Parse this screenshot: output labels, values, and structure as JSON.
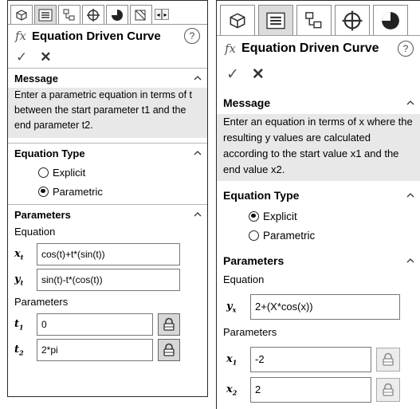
{
  "left_panel": {
    "title": "Equation Driven Curve",
    "help": "?",
    "fx": "fx",
    "ok": "✓",
    "cancel": "✕",
    "message": {
      "header": "Message",
      "text": "Enter a parametric equation in terms of t between the start parameter t1 and the end parameter t2."
    },
    "equation_type": {
      "header": "Equation Type",
      "options": [
        "Explicit",
        "Parametric"
      ],
      "selected": "Parametric"
    },
    "parameters": {
      "header": "Parameters",
      "equation_label": "Equation",
      "xt_var": "x",
      "xt_sub": "t",
      "xt_value": "cos(t)+t*(sin(t))",
      "yt_var": "y",
      "yt_sub": "t",
      "yt_value": "sin(t)-t*(cos(t))",
      "params_label": "Parameters",
      "t1_var": "t",
      "t1_sub": "1",
      "t1_value": "0",
      "t2_var": "t",
      "t2_sub": "2",
      "t2_value": "2*pi"
    }
  },
  "right_panel": {
    "title": "Equation Driven Curve",
    "help": "?",
    "fx": "fx",
    "ok": "✓",
    "cancel": "✕",
    "message": {
      "header": "Message",
      "text": "Enter an equation in terms of x where the resulting y values are calculated according to the start value x1 and the end value x2."
    },
    "equation_type": {
      "header": "Equation Type",
      "options": [
        "Explicit",
        "Parametric"
      ],
      "selected": "Explicit"
    },
    "parameters": {
      "header": "Parameters",
      "equation_label": "Equation",
      "yx_var": "y",
      "yx_sub": "x",
      "yx_value": "2+(X*cos(x))",
      "params_label": "Parameters",
      "x1_var": "x",
      "x1_sub": "1",
      "x1_value": "-2",
      "x2_var": "x",
      "x2_sub": "2",
      "x2_value": "2"
    }
  },
  "icons": [
    "part-icon",
    "property-manager-icon",
    "configuration-manager-icon",
    "dimxpert-icon",
    "display-manager-icon",
    "lock-icon",
    "collapse-chevron-icon"
  ]
}
